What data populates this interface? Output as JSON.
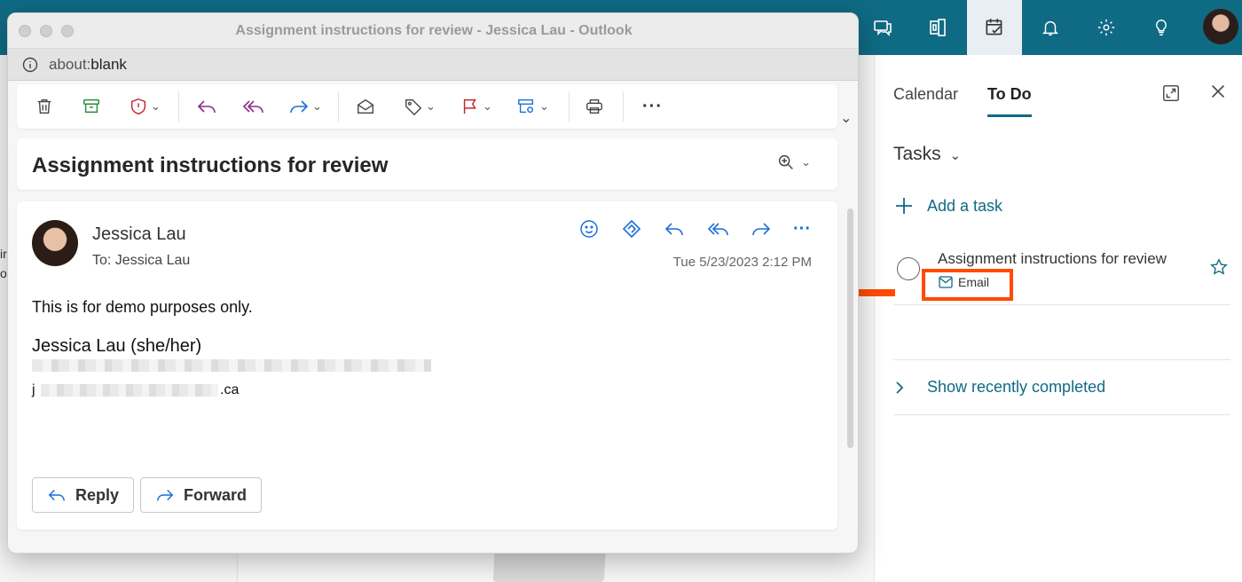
{
  "window": {
    "title": "Assignment instructions for review - Jessica Lau - Outlook",
    "url_prefix": "about:",
    "url_main": "blank"
  },
  "message": {
    "subject": "Assignment instructions for review",
    "sender": "Jessica Lau",
    "to_label": "To:",
    "to_name": "Jessica Lau",
    "date": "Tue 5/23/2023 2:12 PM",
    "body_line": "This is for demo purposes only.",
    "signature_name": "Jessica Lau (she/her)",
    "email_prefix": "j",
    "email_suffix": ".ca",
    "reply_label": "Reply",
    "forward_label": "Forward"
  },
  "right_pane": {
    "tab_calendar": "Calendar",
    "tab_todo": "To Do",
    "tasks_header": "Tasks",
    "add_task": "Add a task",
    "task_title": "Assignment instructions for review",
    "task_tag": "Email",
    "show_completed": "Show recently completed"
  },
  "background": {
    "left_text_line1": "ir",
    "left_text_line2": "o"
  },
  "colors": {
    "brand": "#0f6a84",
    "highlight": "#ff4a00",
    "action_blue": "#1a6fd6"
  }
}
